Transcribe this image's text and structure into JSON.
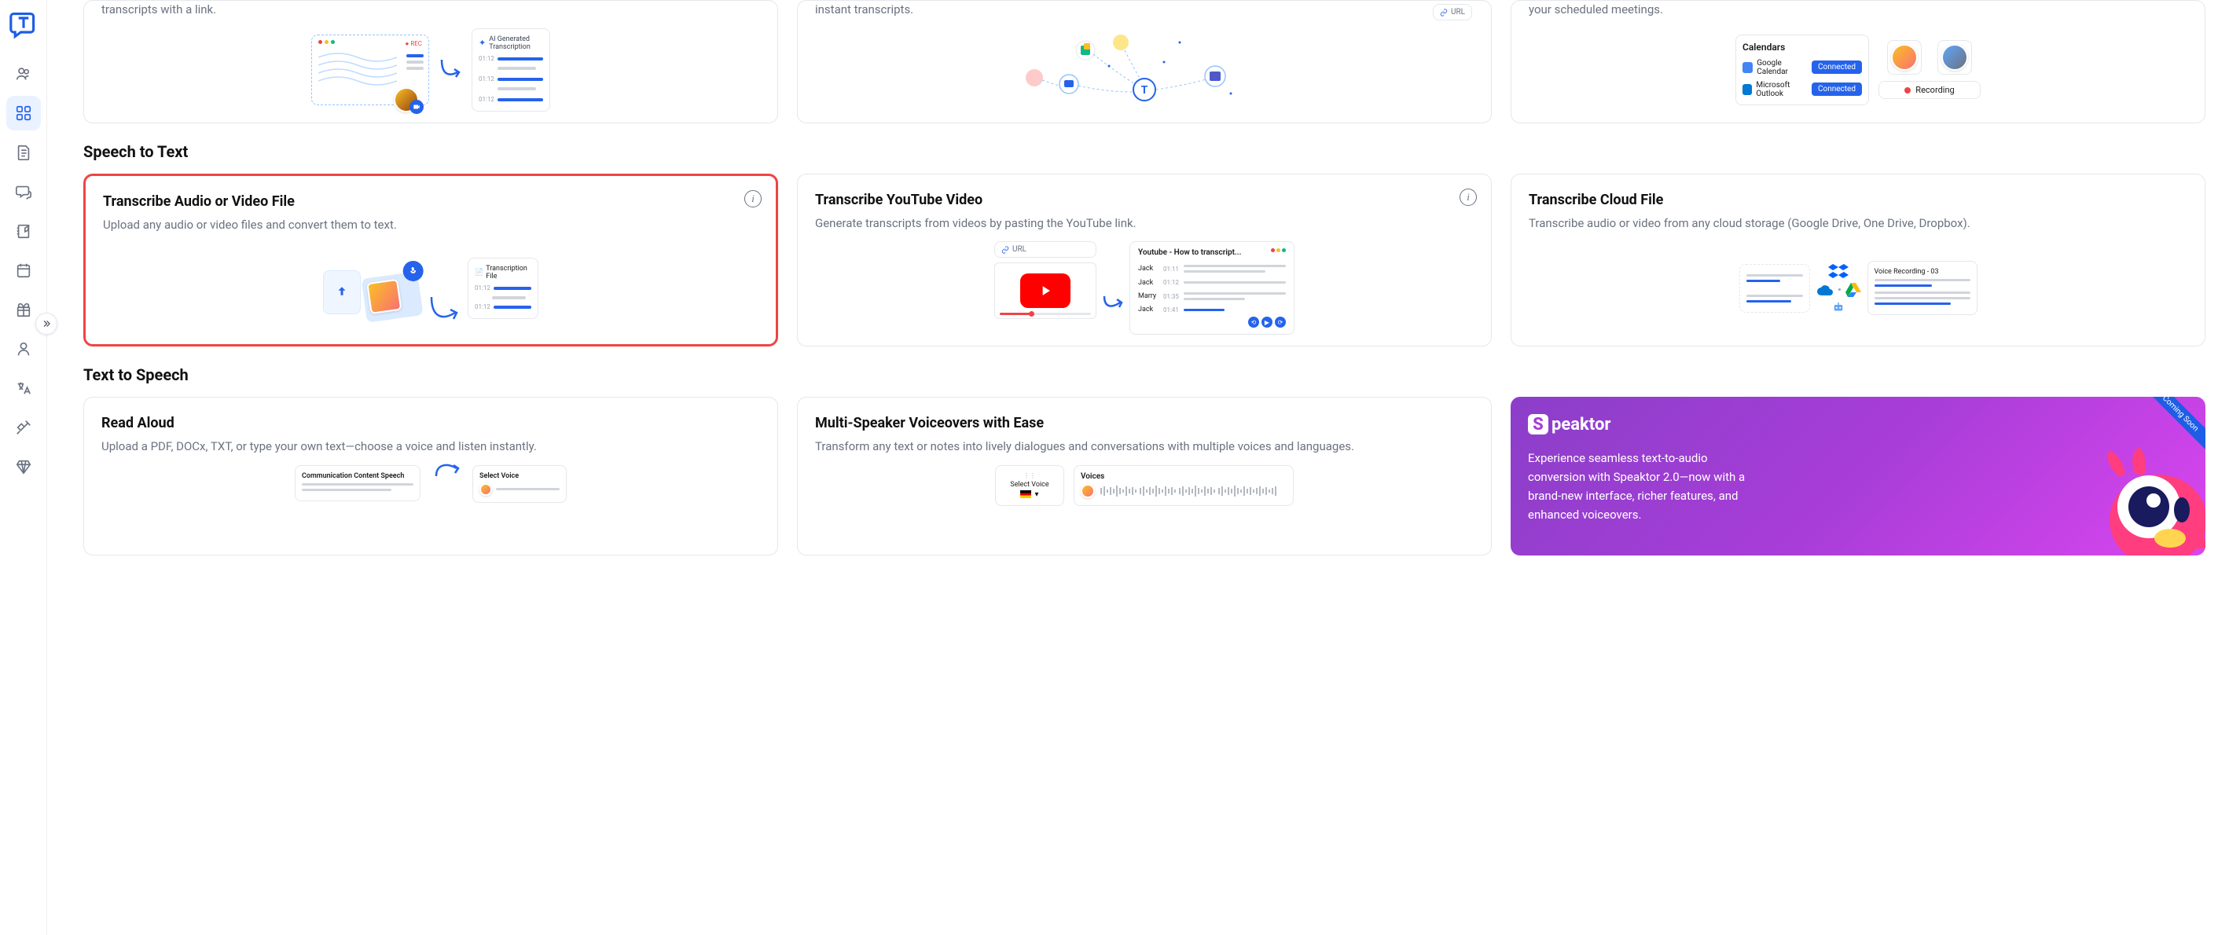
{
  "sidebar": {
    "items": [
      {
        "name": "people"
      },
      {
        "name": "dashboard"
      },
      {
        "name": "document"
      },
      {
        "name": "chat"
      },
      {
        "name": "notes"
      },
      {
        "name": "calendar"
      },
      {
        "name": "gift"
      },
      {
        "name": "profile"
      },
      {
        "name": "translate"
      },
      {
        "name": "plug"
      },
      {
        "name": "diamond"
      }
    ]
  },
  "top_row": {
    "cards": [
      {
        "desc_fragment": "transcripts with a link.",
        "illus": {
          "rec_label": "REC",
          "ai_label": "AI Generated Transcription",
          "times": [
            "01:12",
            "01:12",
            "01:12"
          ]
        }
      },
      {
        "desc_fragment": "instant transcripts.",
        "illus": {
          "url_label": "URL"
        }
      },
      {
        "desc_fragment": "your scheduled meetings.",
        "illus": {
          "header": "Calendars",
          "cal1": "Google Calendar",
          "cal2": "Microsoft Outlook",
          "btn": "Connected",
          "rec": "Recording"
        }
      }
    ]
  },
  "sections": [
    {
      "title": "Speech to Text",
      "cards": [
        {
          "title": "Transcribe Audio or Video File",
          "desc": "Upload any audio or video files and convert them to text.",
          "has_info": true,
          "highlighted": true,
          "illus_type": "upload",
          "illus": {
            "file_label": "Transcription File",
            "times": [
              "01:12",
              "01:12"
            ]
          }
        },
        {
          "title": "Transcribe YouTube Video",
          "desc": "Generate transcripts from videos by pasting the YouTube link.",
          "has_info": true,
          "illus_type": "youtube",
          "illus": {
            "url_label": "URL",
            "yt_title": "Youtube - How to transcript...",
            "speakers": [
              {
                "name": "Jack",
                "time": "01:11"
              },
              {
                "name": "Jack",
                "time": "01:12"
              },
              {
                "name": "Marry",
                "time": "01:35"
              },
              {
                "name": "Jack",
                "time": "01:41"
              }
            ]
          }
        },
        {
          "title": "Transcribe Cloud File",
          "desc": "Transcribe audio or video from any cloud storage (Google Drive, One Drive, Dropbox).",
          "has_info": false,
          "illus_type": "cloud",
          "illus": {
            "rec_title": "Voice Recording - 03"
          }
        }
      ]
    },
    {
      "title": "Text to Speech",
      "cards": [
        {
          "title": "Read Aloud",
          "desc": "Upload a PDF, DOCx, TXT, or type your own text—choose a voice and listen instantly.",
          "illus_type": "readaloud",
          "illus": {
            "doc_label": "Communication Content Speech",
            "voice_label": "Select Voice"
          }
        },
        {
          "title": "Multi-Speaker Voiceovers with Ease",
          "desc": "Transform any text or notes into lively dialogues and conversations with multiple voices and languages.",
          "illus_type": "multispeaker",
          "illus": {
            "select_label": "Select Voice",
            "voices_label": "Voices"
          }
        },
        {
          "type": "promo",
          "logo": "peaktor",
          "text": "Experience seamless text-to-audio conversion with Speaktor 2.0—now with a brand-new interface, richer features, and enhanced voiceovers.",
          "badge": "Coming Soon"
        }
      ]
    }
  ]
}
